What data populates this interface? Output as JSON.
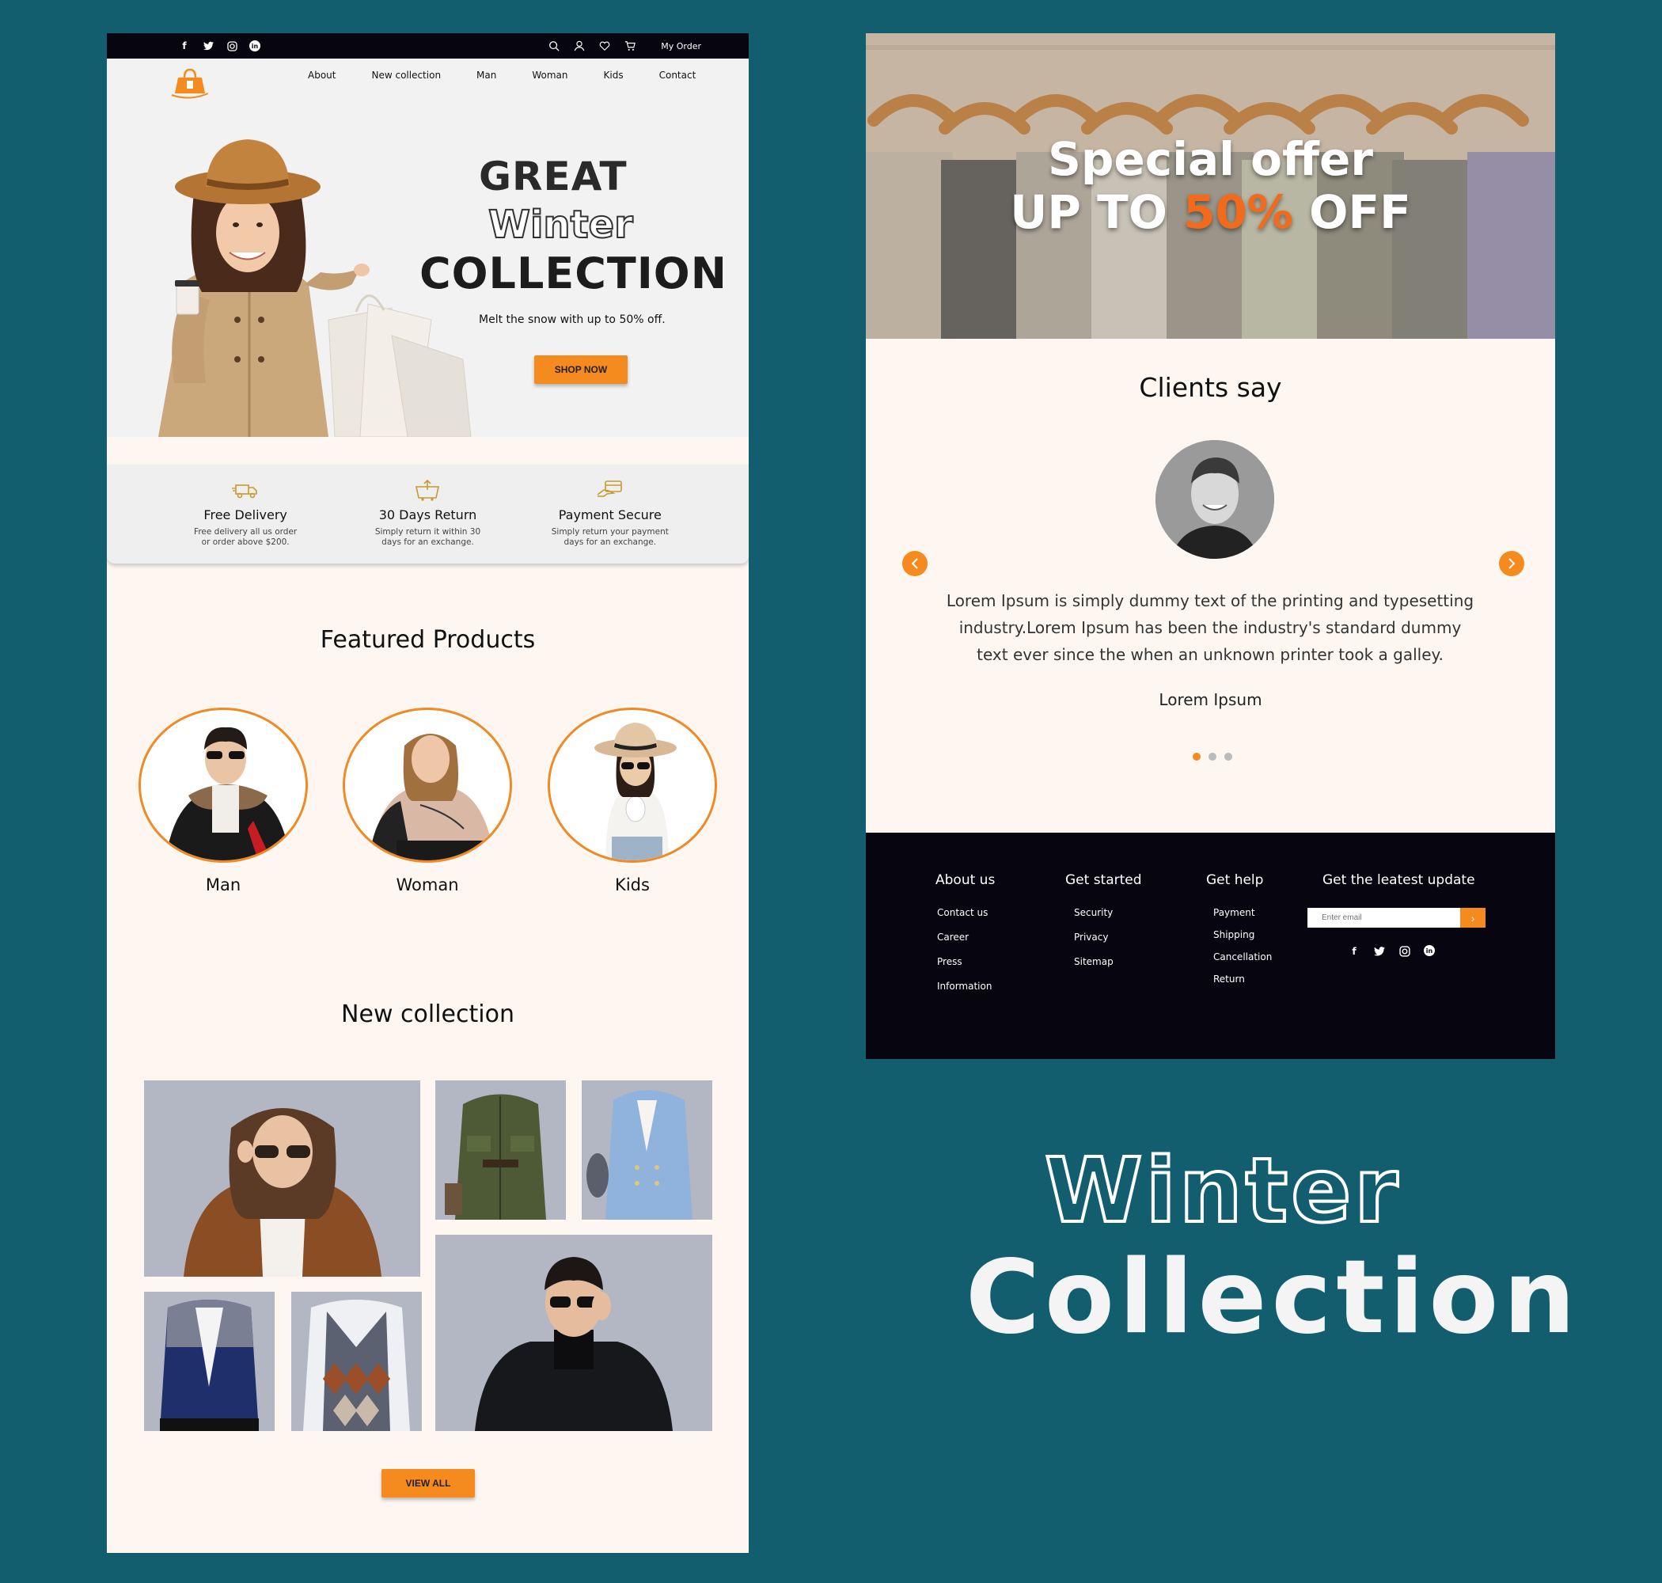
{
  "topbar": {
    "social": [
      "f",
      "t",
      "ig",
      "in"
    ],
    "order_label": "My Order"
  },
  "nav": {
    "items": [
      "About",
      "New collection",
      "Man",
      "Woman",
      "Kids",
      "Contact"
    ]
  },
  "hero": {
    "title_line1": "GREAT",
    "title_line2": "Winter",
    "title_line3": "COLLECTION",
    "subtitle": "Melt the snow with up to 50% off.",
    "cta": "SHOP NOW"
  },
  "features": [
    {
      "icon": "delivery-truck-icon",
      "title": "Free Delivery",
      "desc1": "Free delivery all us order",
      "desc2": "or order above $200."
    },
    {
      "icon": "return-basket-icon",
      "title": "30 Days Return",
      "desc1": "Simply return it within 30",
      "desc2": "days for an exchange."
    },
    {
      "icon": "payment-card-icon",
      "title": "Payment Secure",
      "desc1": "Simply return your payment",
      "desc2": "days for an exchange."
    }
  ],
  "featured": {
    "title": "Featured Products",
    "categories": [
      "Man",
      "Woman",
      "Kids"
    ]
  },
  "collection": {
    "title": "New collection",
    "cta": "VIEW ALL"
  },
  "offer": {
    "line1": "Special offer",
    "line2_pre": "UP TO ",
    "line2_pct": "50%",
    "line2_post": " OFF"
  },
  "clients": {
    "title": "Clients say",
    "quote_l1": "Lorem Ipsum is simply dummy text of the printing and typesetting",
    "quote_l2": "industry.Lorem Ipsum has been the industry's standard dummy",
    "quote_l3": "text ever since the when an unknown printer took a galley.",
    "name": "Lorem Ipsum",
    "prev_icon": "chevron-left-icon",
    "next_icon": "chevron-right-icon"
  },
  "footer": {
    "about": {
      "heading": "About us",
      "links": [
        "Contact us",
        "Career",
        "Press",
        "Information"
      ]
    },
    "started": {
      "heading": "Get started",
      "links": [
        "Security",
        "Privacy",
        "Sitemap"
      ]
    },
    "help": {
      "heading": "Get help",
      "links": [
        "Payment",
        "Shipping",
        "Cancellation",
        "Return"
      ]
    },
    "update": {
      "heading": "Get the leatest update",
      "placeholder": "Enter email",
      "submit": "›"
    }
  },
  "banner": {
    "line1": "Winter",
    "line2": "Collection"
  },
  "colors": {
    "background": "#125e6e",
    "accent": "#f58a1f",
    "dark": "#07050f",
    "panel": "#fdf6f1"
  }
}
